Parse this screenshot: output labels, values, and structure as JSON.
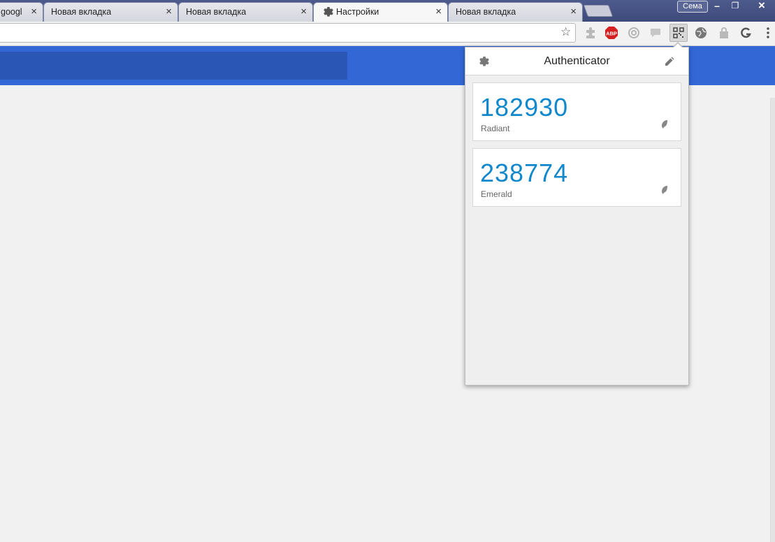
{
  "browser": {
    "tabs": [
      {
        "title": "googl"
      },
      {
        "title": "Новая вкладка"
      },
      {
        "title": "Новая вкладка"
      },
      {
        "title": "Настройки"
      },
      {
        "title": "Новая вкладка"
      }
    ],
    "tab_close_glyph": "×",
    "profile_name": "Сема",
    "window_buttons": {
      "minimize": "–",
      "restore": "❐",
      "close": "×"
    },
    "accent": "#3367d6"
  },
  "toolbar": {
    "bookmark_star_glyph": "☆",
    "extensions": [
      "puzzle-icon",
      "adblock-icon",
      "target-icon",
      "speech-icon",
      "authenticator-qr-icon",
      "globe-icon",
      "lock-icon",
      "grammar-icon"
    ],
    "abp_label": "ABP"
  },
  "popup": {
    "title": "Authenticator",
    "entries": [
      {
        "code": "182930",
        "issuer": "Radiant"
      },
      {
        "code": "238774",
        "issuer": "Emerald"
      }
    ],
    "code_color": "#1188cc"
  }
}
